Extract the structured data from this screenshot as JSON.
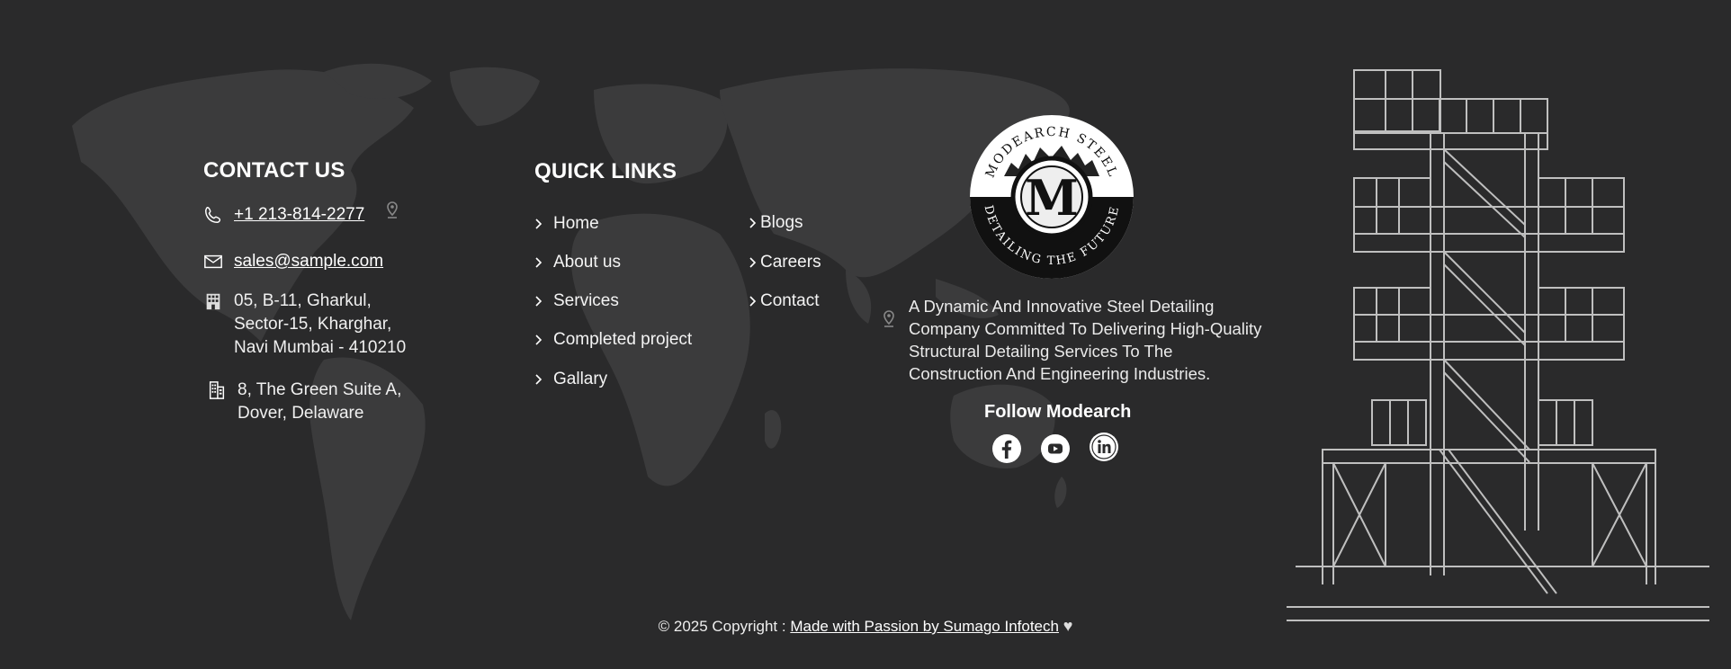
{
  "contact": {
    "heading": "CONTACT US",
    "phone": "+1 213-814-2277",
    "email": "sales@sample.com",
    "address1": [
      "05, B-11, Gharkul,",
      "Sector-15, Kharghar,",
      "Navi Mumbai - 410210"
    ],
    "address2": [
      "8, The Green Suite A,",
      "Dover, Delaware"
    ]
  },
  "quick_links": {
    "heading": "QUICK LINKS",
    "col1": [
      "Home",
      "About us",
      "Services",
      "Completed project",
      "Gallary"
    ],
    "col2": [
      "Blogs",
      "Careers",
      "Contact"
    ]
  },
  "brand": {
    "logo_top_text": "MODEARCH STEEL",
    "logo_bottom_text": "DETAILING THE FUTURE",
    "logo_letter": "M",
    "description": "A Dynamic And Innovative Steel Detailing Company Committed To Delivering High-Quality Structural Detailing Services To The Construction And Engineering Industries.",
    "follow_label": "Follow Modearch",
    "socials": [
      "facebook-icon",
      "youtube-icon",
      "linkedin-icon"
    ]
  },
  "footer": {
    "copyright": "© 2025 Copyright :",
    "credit_link": "Made with Passion by Sumago Infotech",
    "heart": "♥"
  },
  "colors": {
    "background": "#2a2a2b",
    "map": "#3a3a3b",
    "text": "#ffffff"
  }
}
